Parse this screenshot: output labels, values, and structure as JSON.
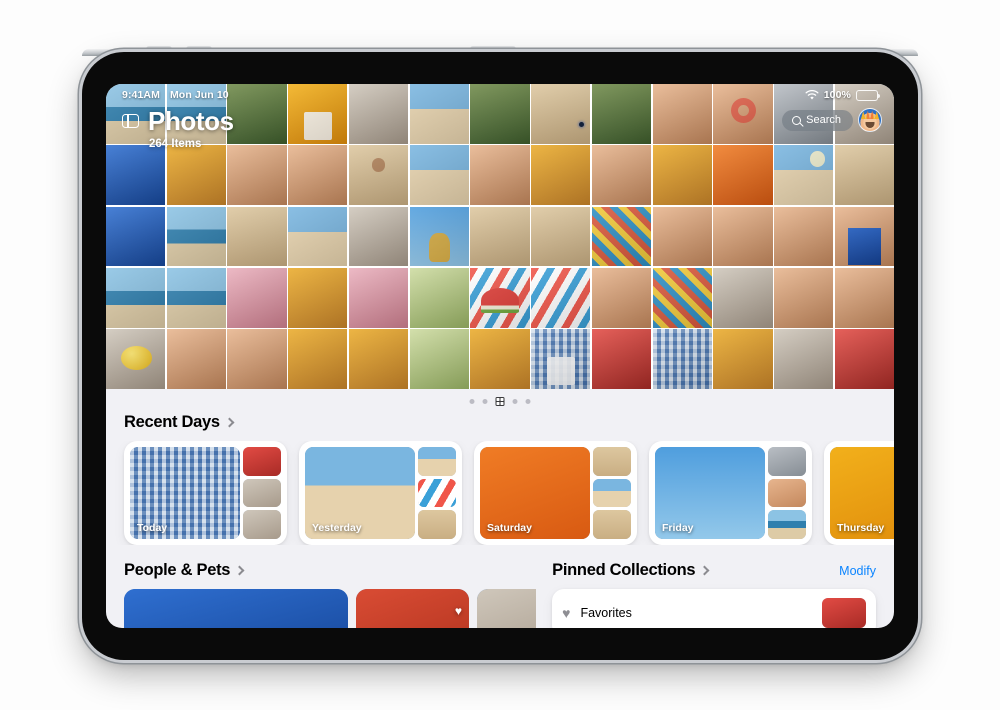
{
  "device": {
    "name": "iPad"
  },
  "statusbar": {
    "time": "9:41AM",
    "date": "Mon Jun 10",
    "battery_percent": "100%",
    "wifi_icon": "wifi-icon",
    "battery_icon": "battery-icon"
  },
  "header": {
    "sidebar_icon": "sidebar-toggle-icon",
    "title": "Photos",
    "subtitle": "264 Items",
    "search_label": "Search",
    "search_icon": "search-icon",
    "avatar_icon": "avatar-icon"
  },
  "page_indicator": {
    "total": 5,
    "active_index": 2,
    "active_icon": "grid-icon"
  },
  "recent_days": {
    "title": "Recent Days",
    "chevron_icon": "chevron-right-icon",
    "cards": [
      {
        "label": "Today",
        "main_class": "plaid",
        "thumbs": [
          "melon",
          "indoor",
          "indoor"
        ]
      },
      {
        "label": "Yesterday",
        "main_class": "beach",
        "thumbs": [
          "beach",
          "stripes",
          "sand"
        ]
      },
      {
        "label": "Saturday",
        "main_class": "orange",
        "thumbs": [
          "sand",
          "beach",
          "sand"
        ]
      },
      {
        "label": "Friday",
        "main_class": "sky",
        "thumbs": [
          "greyB",
          "skin",
          "sea"
        ]
      },
      {
        "label": "Thursday",
        "main_class": "yellow",
        "thumbs": [
          "grass",
          "yellow",
          "orange"
        ]
      }
    ]
  },
  "people_pets": {
    "title": "People & Pets",
    "chevron_icon": "chevron-right-icon",
    "cards": [
      {
        "name": "person-card-1",
        "bg": "blueH",
        "favorite": false,
        "wide": true
      },
      {
        "name": "person-card-2",
        "bg": "redH",
        "favorite": true,
        "wide": false
      },
      {
        "name": "person-card-3",
        "bg": "indoor",
        "favorite": true,
        "wide": false
      },
      {
        "name": "person-card-4",
        "bg": "greyB",
        "favorite": true,
        "wide": false
      }
    ],
    "heart_icon": "heart-icon"
  },
  "pinned_collections": {
    "title": "Pinned Collections",
    "chevron_icon": "chevron-right-icon",
    "modify_label": "Modify",
    "items": [
      {
        "label": "Favorites",
        "icon": "heart-icon",
        "thumb": "melon"
      }
    ]
  },
  "colors": {
    "accent_blue": "#0a84ff",
    "screen_bg": "#f1f1f5",
    "card_white": "#ffffff",
    "page_bg": "#fdfdfd",
    "frame_black": "#0a0a0a"
  },
  "grid_photos": [
    "sea",
    "sea",
    "grass",
    "yellow",
    "indoor",
    "beach",
    "grass",
    "sand",
    "grass",
    "skin",
    "skin",
    "greyB",
    "indoor",
    "blueH",
    "cloth",
    "skin",
    "skin",
    "sand",
    "beach",
    "skin",
    "cloth",
    "skin",
    "cloth",
    "orange",
    "beach",
    "sand",
    "blueH",
    "sea",
    "sand",
    "beach",
    "indoor",
    "sky",
    "sand",
    "sand",
    "tiles",
    "skin",
    "skin",
    "skin",
    "skin",
    "sea",
    "sea",
    "pinkH",
    "cloth",
    "pinkH",
    "mint",
    "stripes",
    "stripes",
    "skin",
    "tiles",
    "indoor",
    "skin",
    "skin",
    "indoor",
    "skin",
    "skin",
    "cloth",
    "cloth",
    "mint",
    "cloth",
    "plaid",
    "melon",
    "plaid",
    "cloth",
    "indoor",
    "melon"
  ]
}
